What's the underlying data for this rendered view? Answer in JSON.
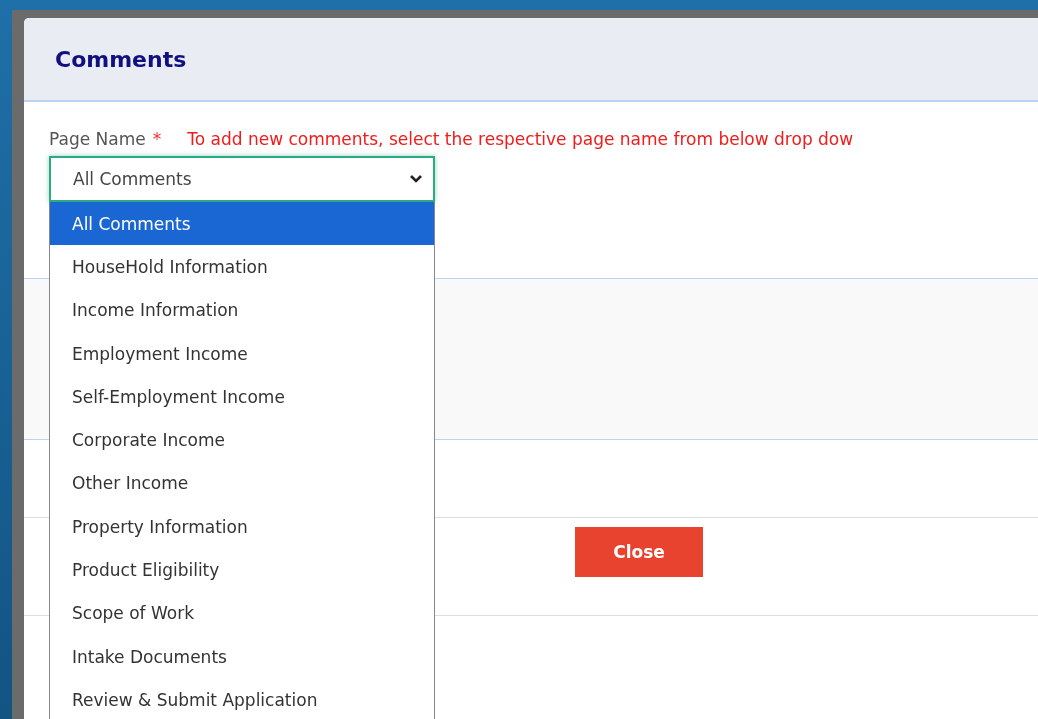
{
  "dialog": {
    "title": "Comments",
    "field_label": "Page Name",
    "required_mark": "*",
    "hint": "To add new comments, select the respective page name from below drop dow",
    "select": {
      "value": "All Comments",
      "expanded": true
    },
    "options": [
      {
        "label": "All Comments",
        "selected": true
      },
      {
        "label": "HouseHold Information",
        "selected": false
      },
      {
        "label": "Income Information",
        "selected": false
      },
      {
        "label": "Employment Income",
        "selected": false
      },
      {
        "label": "Self-Employment Income",
        "selected": false
      },
      {
        "label": "Corporate Income",
        "selected": false
      },
      {
        "label": "Other Income",
        "selected": false
      },
      {
        "label": "Property Information",
        "selected": false
      },
      {
        "label": "Product Eligibility",
        "selected": false
      },
      {
        "label": "Scope of Work",
        "selected": false
      },
      {
        "label": "Intake Documents",
        "selected": false
      },
      {
        "label": "Review & Submit Application",
        "selected": false
      }
    ],
    "close_button": "Close"
  }
}
